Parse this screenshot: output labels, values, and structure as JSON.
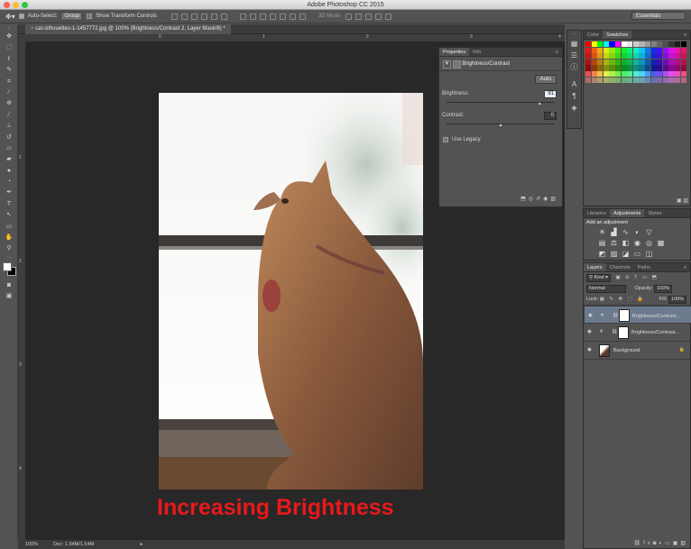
{
  "app": {
    "title": "Adobe Photoshop CC 2015"
  },
  "options": {
    "auto_select_label": "Auto-Select:",
    "auto_select_value": "Group",
    "transform_label": "Show Transform Controls",
    "mode_3d": "3D Mode:",
    "workspace": "Essentials"
  },
  "document": {
    "tab_title": "cat-silhouettes-1-1457772.jpg @ 100% (Brightness/Contrast 2, Layer Mask/8) *",
    "zoom": "100%",
    "doc_info": "Doc: 1.54M/1.54M",
    "ruler_h": [
      "0",
      "1",
      "2",
      "3",
      "4"
    ],
    "ruler_v": [
      "1",
      "2",
      "3",
      "4"
    ],
    "caption": "Increasing Brightness"
  },
  "properties": {
    "tabs": [
      "Properties",
      "Info"
    ],
    "title": "Brightness/Contrast",
    "auto_label": "Auto",
    "brightness_label": "Brightness:",
    "brightness_value": "91",
    "contrast_label": "Contrast:",
    "contrast_value": "0",
    "brightness_slider": 0.86,
    "contrast_slider": 0.5,
    "legacy_label": "Use Legacy"
  },
  "swatches": {
    "tabs": [
      "Color",
      "Swatches"
    ]
  },
  "adjustments": {
    "tabs": [
      "Libraries",
      "Adjustments",
      "Styles"
    ],
    "add_label": "Add an adjustment"
  },
  "layers": {
    "tabs": [
      "Layers",
      "Channels",
      "Paths"
    ],
    "filter": "Kind",
    "blend": "Normal",
    "opacity_label": "Opacity:",
    "opacity_value": "100%",
    "lock_label": "Lock:",
    "fill_label": "Fill:",
    "fill_value": "100%",
    "items": [
      {
        "name": "Brightness/Contrast...",
        "selected": true
      },
      {
        "name": "Brightness/Contrast...",
        "selected": false
      },
      {
        "name": "Background",
        "selected": false
      }
    ]
  }
}
